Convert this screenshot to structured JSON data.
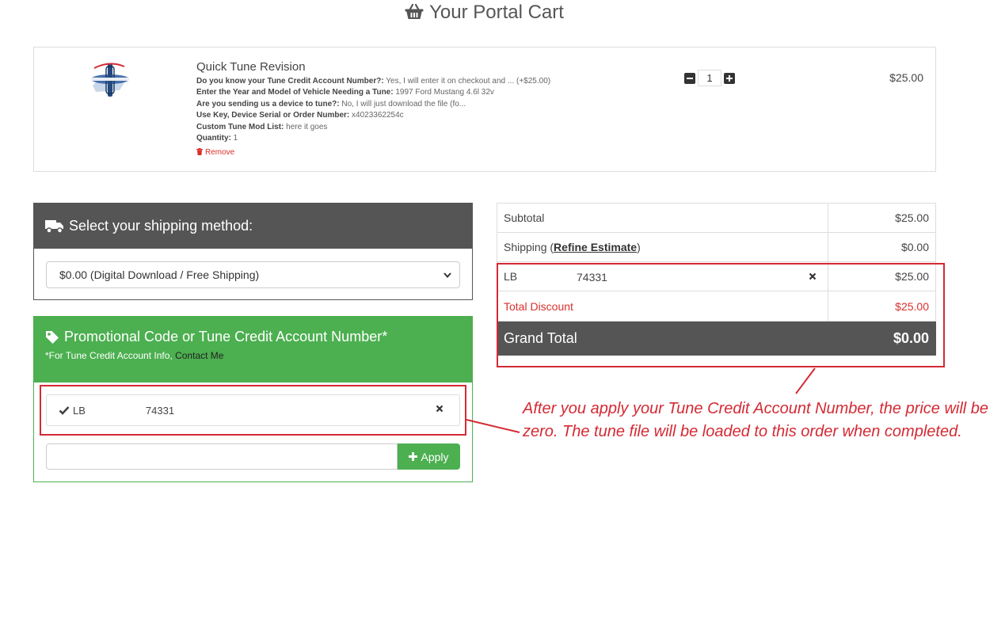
{
  "header": {
    "title": "Your Portal Cart",
    "icon": "basket-icon"
  },
  "cart_item": {
    "name": "Quick Tune Revision",
    "options": [
      {
        "label": "Do you know your Tune Credit Account Number?",
        "value": " Yes, I will enter it on checkout and ... (+$25.00)"
      },
      {
        "label": "Enter the Year and Model of Vehicle Needing a Tune",
        "value": " 1997 Ford Mustang 4.6l 32v"
      },
      {
        "label": "Are you sending us a device to tune?",
        "value": " No, I will just download the file (fo..."
      },
      {
        "label": "Use Key, Device Serial or Order Number",
        "value": " x4023362254c"
      },
      {
        "label": "Custom Tune Mod List",
        "value": " here it goes"
      },
      {
        "label": "Quantity",
        "value": " 1"
      }
    ],
    "remove_label": "Remove",
    "quantity": "1",
    "price": "$25.00"
  },
  "shipping": {
    "title": "Select your shipping method:",
    "selected": "$0.00 (Digital Download / Free Shipping)"
  },
  "promo": {
    "title": "Promotional Code or Tune Credit Account Number*",
    "note_prefix": "*For Tune Credit Account Info, ",
    "note_link": "Contact Me",
    "applied_label": "LB",
    "applied_number": "74331",
    "input_value": "",
    "apply_label": "Apply"
  },
  "totals": {
    "subtotal_label": "Subtotal",
    "subtotal_value": "$25.00",
    "shipping_prefix": "Shipping (",
    "shipping_link": "Refine Estimate",
    "shipping_suffix": ")",
    "shipping_value": "$0.00",
    "discount_label": "LB",
    "discount_number": "74331",
    "discount_value": "$25.00",
    "total_discount_label": "Total Discount",
    "total_discount_value": "$25.00",
    "grand_label": "Grand Total",
    "grand_value": "$0.00"
  },
  "annotation": {
    "text": "After you apply your Tune Credit Account Number, the price will be zero. The tune file will be loaded to this order when completed.",
    "color": "#d42a34"
  },
  "colors": {
    "green": "#4caf50",
    "dark": "#555555",
    "red": "#d9302c"
  }
}
